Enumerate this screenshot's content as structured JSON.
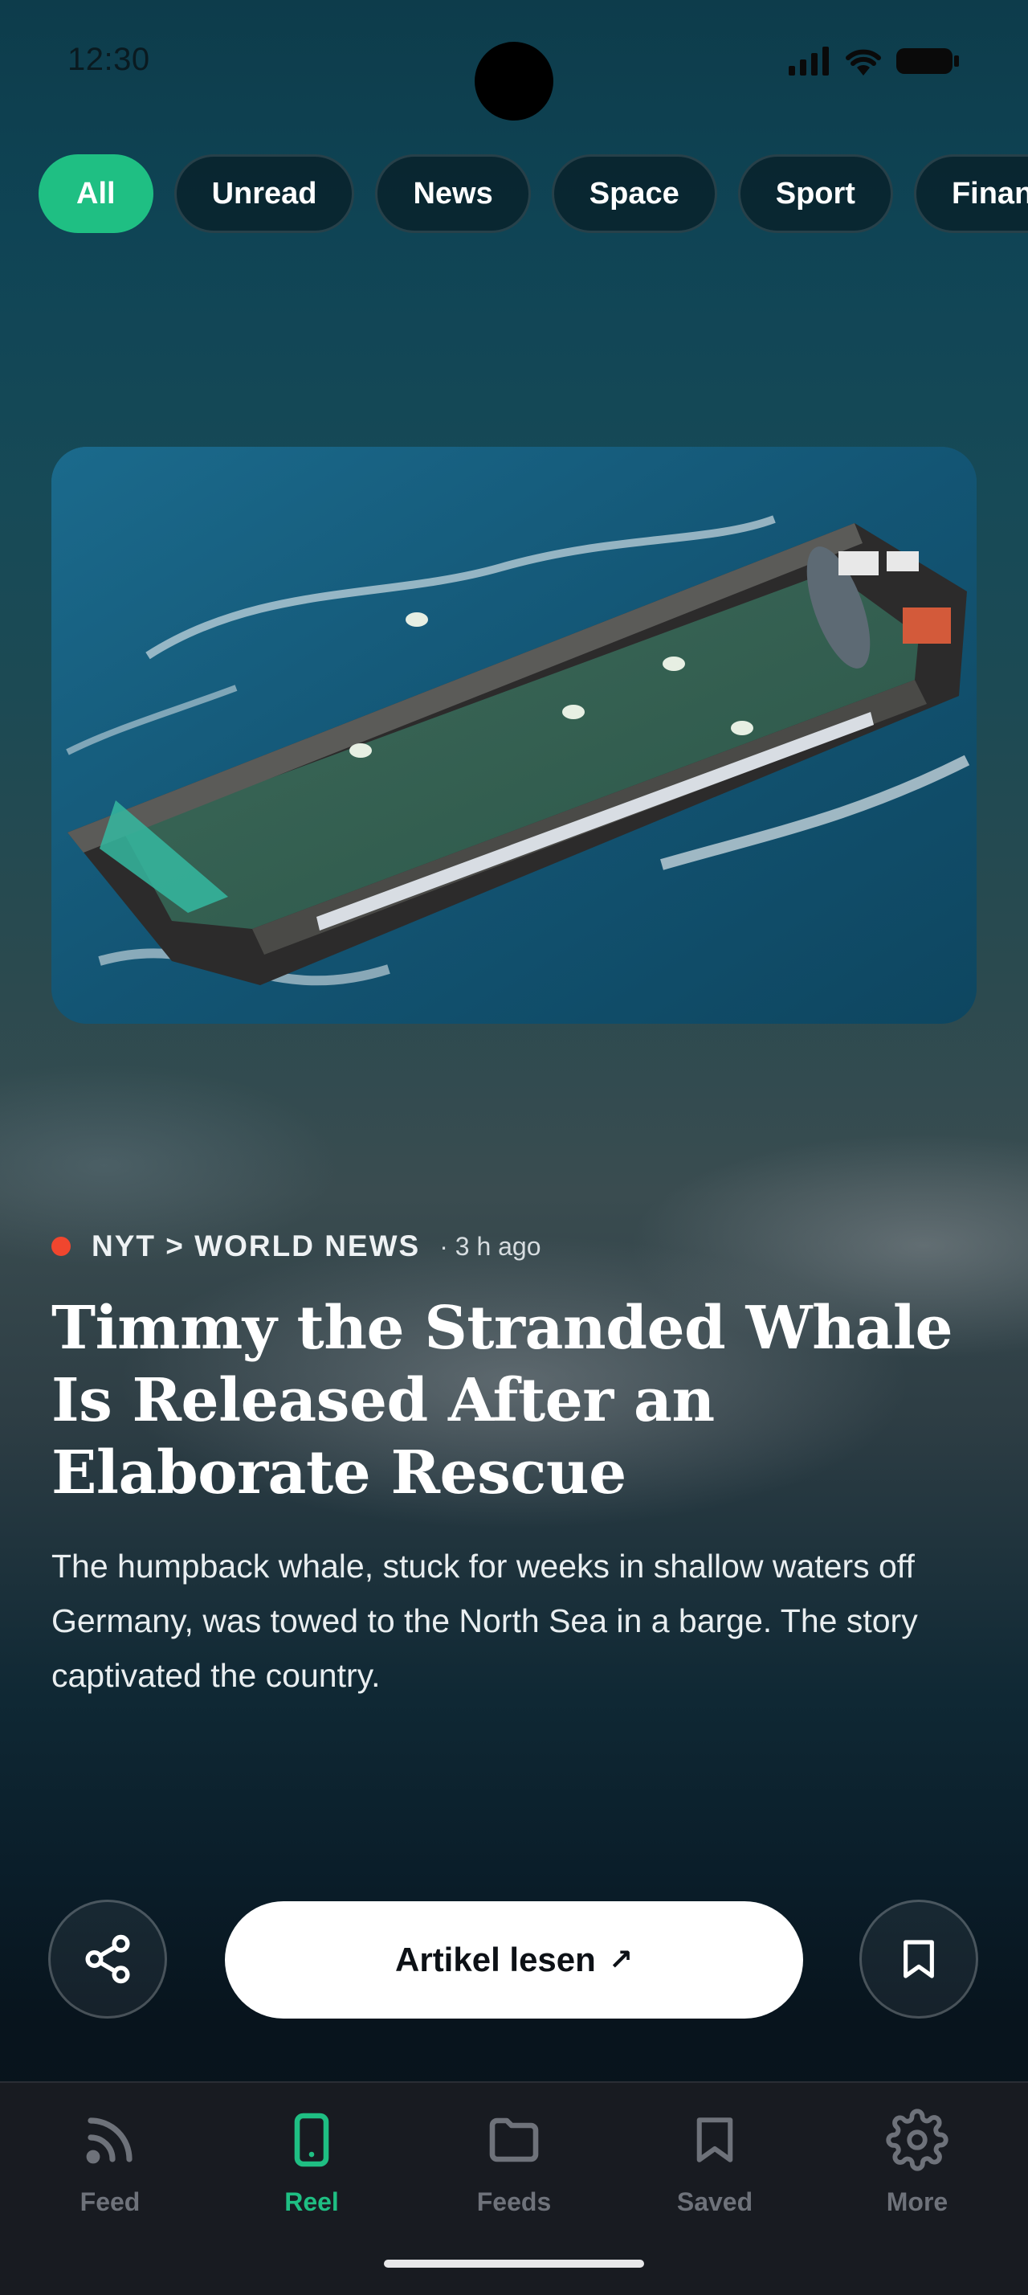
{
  "status_bar": {
    "time": "12:30"
  },
  "filters": [
    {
      "label": "All",
      "active": true
    },
    {
      "label": "Unread",
      "active": false
    },
    {
      "label": "News",
      "active": false
    },
    {
      "label": "Space",
      "active": false
    },
    {
      "label": "Sport",
      "active": false
    },
    {
      "label": "Finance",
      "active": false
    }
  ],
  "article": {
    "source": "NYT > WORLD NEWS",
    "time_ago": "· 3 h ago",
    "headline": "Timmy the Stranded Whale Is Released After an Elaborate Rescue",
    "summary": "The humpback whale, stuck for weeks in shallow waters off Germany, was towed to the North Sea in a barge. The story captivated the country.",
    "image_icon": "whale-barge-photo"
  },
  "actions": {
    "share_icon": "share-icon",
    "read_label": "Artikel lesen",
    "read_arrow": "↗",
    "bookmark_icon": "bookmark-icon"
  },
  "nav": {
    "items": [
      {
        "label": "Feed",
        "icon": "rss-icon",
        "active": false
      },
      {
        "label": "Reel",
        "icon": "phone-icon",
        "active": true
      },
      {
        "label": "Feeds",
        "icon": "folder-icon",
        "active": false
      },
      {
        "label": "Saved",
        "icon": "bookmark-icon",
        "active": false
      },
      {
        "label": "More",
        "icon": "gear-icon",
        "active": false
      }
    ]
  },
  "colors": {
    "accent": "#1fbf83",
    "live_dot": "#f0462e",
    "nav_background": "#181b21"
  }
}
